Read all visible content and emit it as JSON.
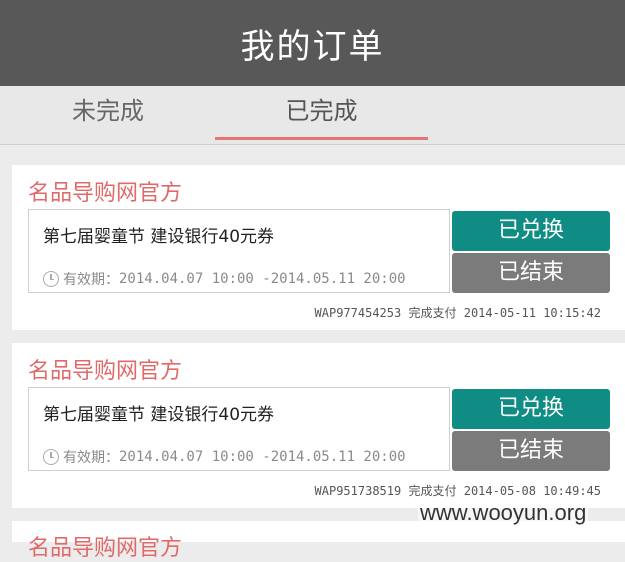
{
  "header": {
    "title": "我的订单"
  },
  "tabs": [
    {
      "label": "未完成"
    },
    {
      "label": "已完成"
    }
  ],
  "orders": [
    {
      "shop": "名品导购网官方",
      "coupon_name": "第七届婴童节 建设银行40元券",
      "validity_label": "有效期：",
      "validity_range": "2014.04.07 10:00 -2014.05.11 20:00",
      "status_redeemed": "已兑换",
      "status_ended": "已结束",
      "order_no": "WAP977454253",
      "payment": "完成支付",
      "timestamp": "2014-05-11 10:15:42"
    },
    {
      "shop": "名品导购网官方",
      "coupon_name": "第七届婴童节 建设银行40元券",
      "validity_label": "有效期：",
      "validity_range": "2014.04.07 10:00 -2014.05.11 20:00",
      "status_redeemed": "已兑换",
      "status_ended": "已结束",
      "order_no": "WAP951738519",
      "payment": "完成支付",
      "timestamp": "2014-05-08 10:49:45"
    },
    {
      "shop": "名品导购网官方"
    }
  ],
  "watermark": "www.wooyun.org",
  "colors": {
    "header_bg": "#585858",
    "accent_red": "#e06a6a",
    "redeemed_btn": "#0f8c83",
    "ended_btn": "#7b7b7b"
  }
}
